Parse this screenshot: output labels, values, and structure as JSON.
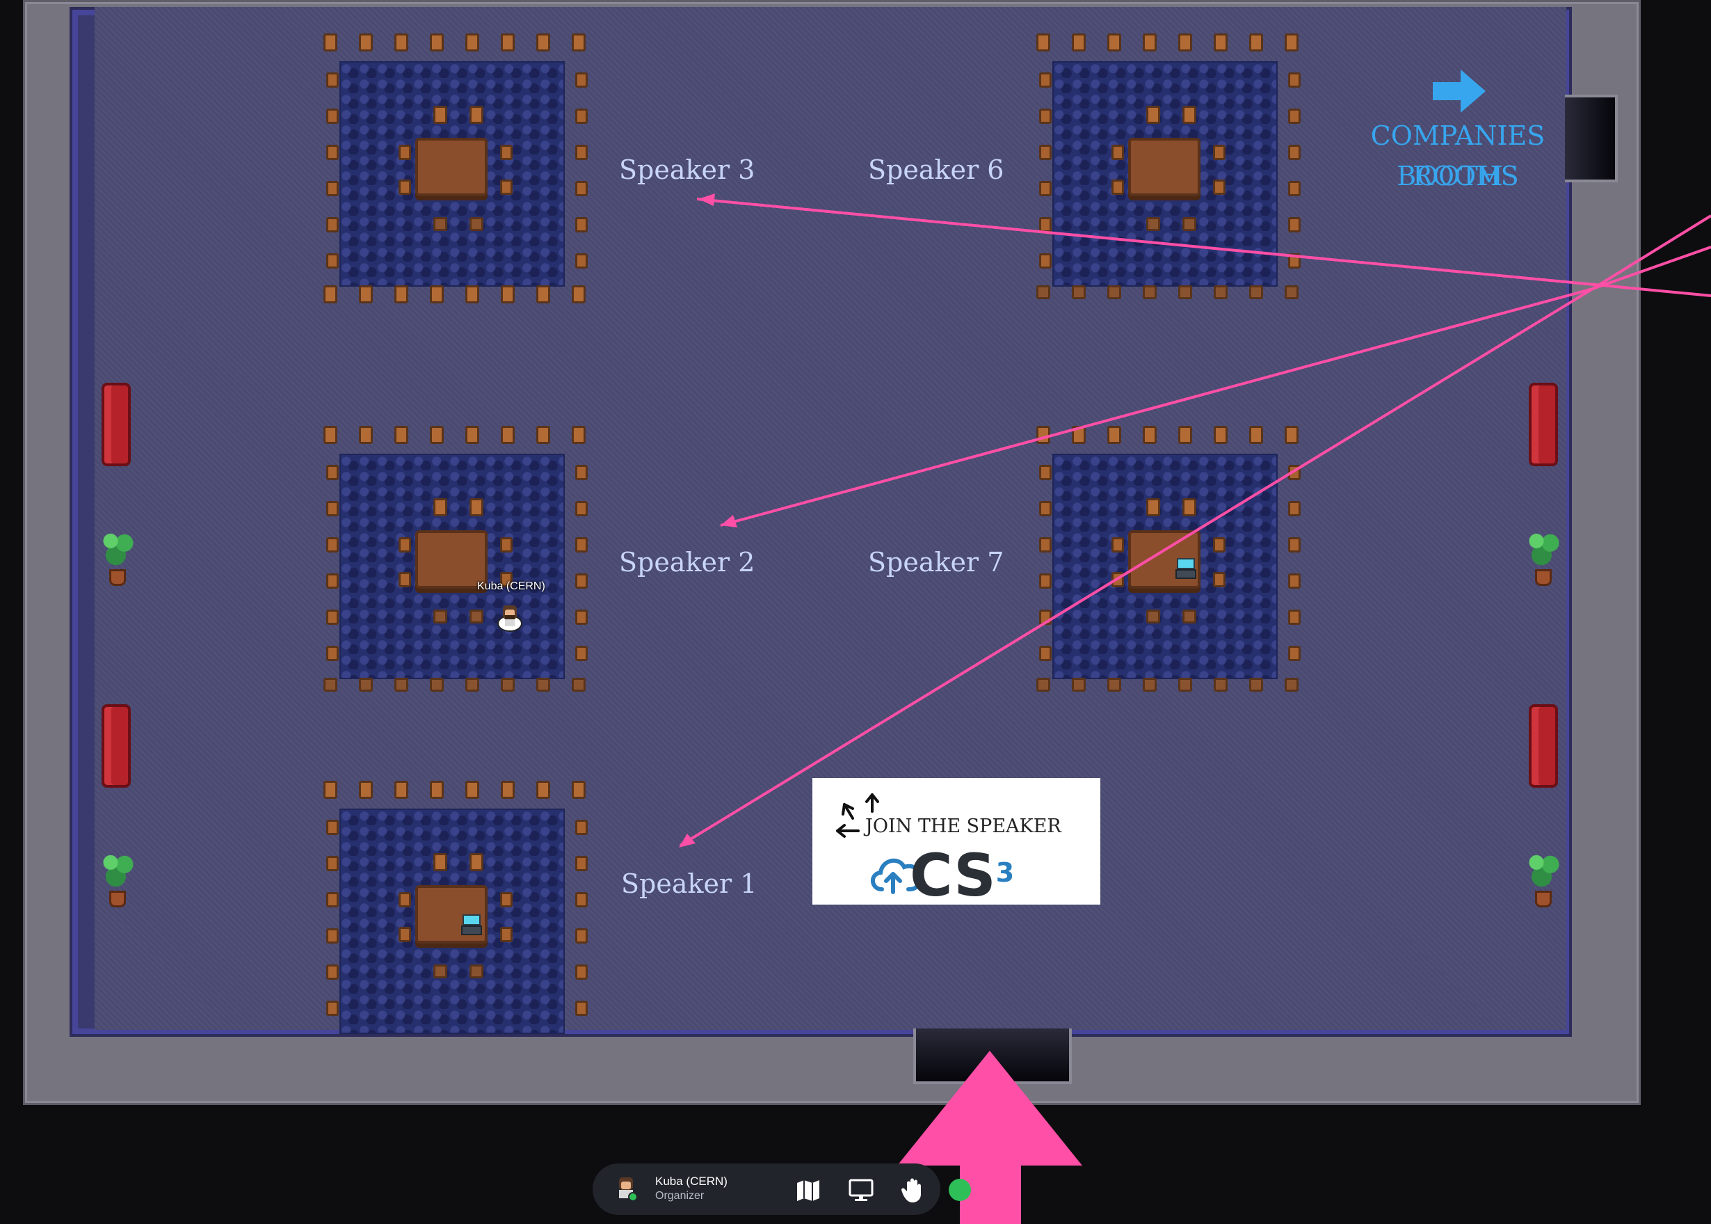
{
  "map": {
    "speaker_labels": {
      "s3": "Speaker 3",
      "s6": "Speaker 6",
      "s2": "Speaker 2",
      "s7": "Speaker 7",
      "s1": "Speaker 1"
    },
    "companies_booths_line1": "COMPANIES BOOTHS",
    "companies_booths_line2": "ROOM",
    "sign": {
      "join_text": "JOIN THE SPEAKER",
      "logo_text": "CS",
      "logo_superscript": "3"
    },
    "avatar_name": "Kuba (CERN)"
  },
  "toolbar": {
    "user_name": "Kuba (CERN)",
    "user_role": "Organizer",
    "icons": [
      "map-icon",
      "screen-share-icon",
      "raise-hand-icon",
      "status-icon"
    ]
  },
  "colors": {
    "annotation_arrows": "#ff4fa6",
    "booths_text": "#37a6ee",
    "speaker_text": "#c9d5f6"
  }
}
